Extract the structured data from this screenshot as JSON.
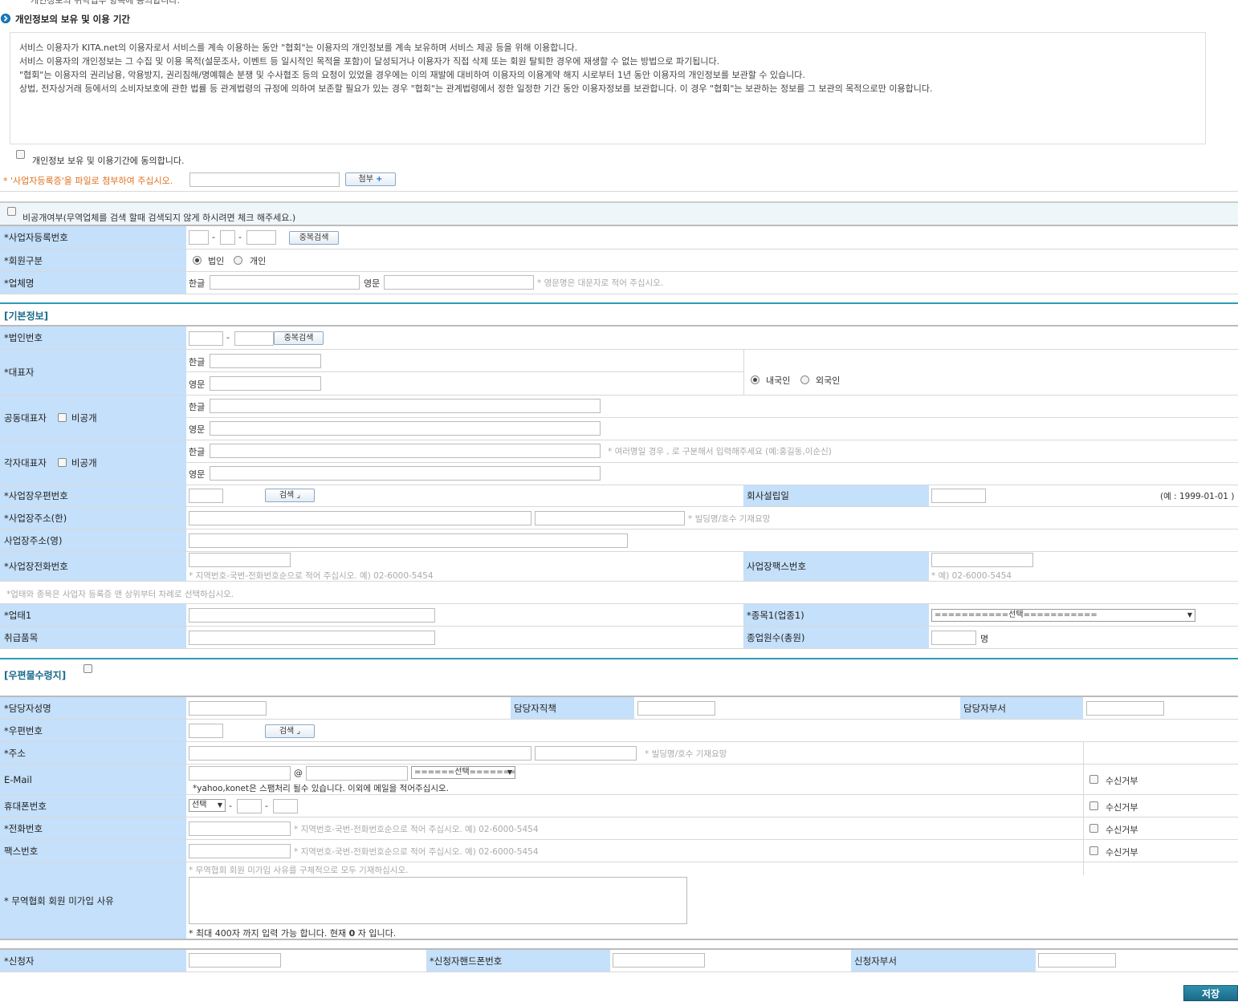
{
  "top_cut_text": "개인정보의 위탁업무 항목에 동의합니다.",
  "retention": {
    "title": "개인정보의 보유 및 이용 기간",
    "lines": [
      "서비스 이용자가 KITA.net의 이용자로서 서비스를 계속 이용하는 동안 \"협회\"는 이용자의 개인정보를 계속 보유하며 서비스 제공 등을 위해 이용합니다.",
      "서비스 이용자의 개인정보는 그 수집 및 이용 목적(설문조사, 이벤트 등 일시적인 목적을 포함)이 달성되거나 이용자가 직접 삭제 또는 회원 탈퇴한 경우에 재생할 수 없는 방법으로 파기됩니다.",
      "\"협회\"는 이용자의 권리남용, 악용방지, 권리침해/명예훼손 분쟁 및 수사협조 등의 요청이 있었을 경우에는 이의 재발에 대비하여 이용자의 이용계약 해지 시로부터 1년 동안 이용자의 개인정보를 보관할 수 있습니다.",
      "상법, 전자상거래 등에서의 소비자보호에 관한 법률 등 관계법령의 규정에 의하여 보존할 필요가 있는 경우 \"협회\"는 관계법령에서 정한 일정한 기간 동안 이용자정보를 보관합니다. 이 경우 \"협회\"는 보관하는 정보를 그 보관의 목적으로만 이용합니다."
    ],
    "agree_label": "개인정보 보유 및 이용기간에 동의합니다."
  },
  "attach": {
    "notice": "* '사업자등록증'을 파일로 첨부하여 주십시오.",
    "button": "첨부"
  },
  "private_label": "비공개여부(무역업체를 검색 할때 검색되지 않게 하시려면 체크 해주세요.)",
  "biz": {
    "reg_no_label": "*사업자등록번호",
    "dup_button": "중복검색",
    "member_type_label": "*회원구분",
    "type_corp": "법인",
    "type_indiv": "개인",
    "company_label": "*업체명",
    "kor": "한글",
    "eng": "영문",
    "eng_hint": "* 영문명은 대문자로 적어 주십시오."
  },
  "basic": {
    "title": "[기본정보]",
    "corp_no_label": "*법인번호",
    "dup_button": "중복검색",
    "rep_label": "*대표자",
    "kor": "한글",
    "eng": "영문",
    "domestic": "내국인",
    "foreign": "외국인",
    "co_rep_label": "공동대표자",
    "private": "비공개",
    "each_rep_label": "각자대표자",
    "multi_hint": "* 여러명일 경우 , 로 구분해서 입력해주세요 (예:홍길동,이순신)",
    "zip_label": "*사업장우편번호",
    "search_button": "검색",
    "founded_label": "회사설립일",
    "founded_example": "(예 : 1999-01-01 )",
    "addr_kor_label": "*사업장주소(한)",
    "addr_hint": "* 빌딩명/호수 기재요망",
    "addr_eng_label": "사업장주소(영)",
    "phone_label": "*사업장전화번호",
    "phone_hint": "* 지역번호-국번-전화번호순으로 적어 주십시오. 예) 02-6000-5454",
    "fax_label": "사업장팩스번호",
    "fax_hint": "* 예) 02-6000-5454",
    "biz_type_note": "*업태와 종목은 사업자 등록증 맨 상위부터 차례로 선택하십시오.",
    "biz_type_label": "*업태1",
    "item_label": "*종목1(업종1)",
    "item_select": "===========선택===========",
    "goods_label": "취급품목",
    "employees_label": "종업원수(총원)",
    "employees_unit": "명"
  },
  "mail": {
    "title": "[우편물수령지]",
    "name_label": "*담당자성명",
    "position_label": "담당자직책",
    "dept_label": "담당자부서",
    "zip_label": "*우편번호",
    "search_button": "검색",
    "addr_label": "*주소",
    "addr_hint": "* 빌딩명/호수 기재요망",
    "email_label": "E-Mail",
    "at": "@",
    "email_select": "======선택=======",
    "email_hint": "*yahoo,konet은 스팸처리 될수 있습니다. 이외에 메일을 적어주십시오.",
    "mobile_label": "휴대폰번호",
    "mobile_select": "선택",
    "phone_label": "*전화번호",
    "phone_hint": "* 지역번호-국번-전화번호순으로 적어 주십시오. 예) 02-6000-5454",
    "fax_label": "팩스번호",
    "fax_hint": "* 지역번호-국번-전화번호순으로 적어 주십시오. 예) 02-6000-5454",
    "refuse": "수신거부",
    "reason_label": "* 무역협회 회원 미가입 사유",
    "reason_hint": "* 무역협회 회원 미가입 사유를 구체적으로 모두 기재하십시오.",
    "limit_pre": "* 최대 400자 까지 입력 가능 합니다. 현재 ",
    "limit_count": "0",
    "limit_post": " 자 입니다."
  },
  "applicant": {
    "name_label": "*신청자",
    "mobile_label": "*신청자핸드폰번호",
    "dept_label": "신청자부서"
  },
  "save_button": "저장"
}
